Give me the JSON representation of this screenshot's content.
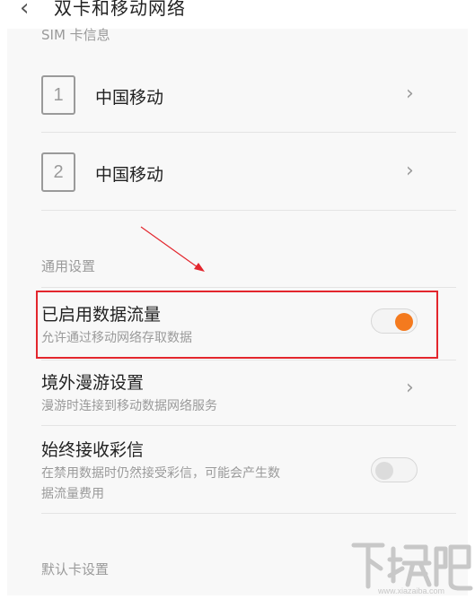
{
  "header": {
    "back_icon": "chevron-left-icon",
    "title": "双卡和移动网络"
  },
  "sim_section": {
    "label": "SIM 卡信息",
    "cards": [
      {
        "slot": "1",
        "name": "中国移动"
      },
      {
        "slot": "2",
        "name": "中国移动"
      }
    ]
  },
  "general_section": {
    "label": "通用设置",
    "items": [
      {
        "title": "已启用数据流量",
        "subtitle": "允许通过移动网络存取数据",
        "control": "toggle",
        "enabled": true
      },
      {
        "title": "境外漫游设置",
        "subtitle": "漫游时连接到移动数据网络服务",
        "control": "chevron"
      },
      {
        "title": "始终接收彩信",
        "subtitle_line1": "在禁用数据时仍然接受彩信，可能会产生数",
        "subtitle_line2": "据流量费用",
        "control": "toggle",
        "enabled": false
      }
    ]
  },
  "default_card_section": {
    "label": "默认卡设置"
  },
  "annotation": {
    "arrow_color": "#e3262d",
    "box_color": "#e3262d"
  },
  "colors": {
    "accent": "#f47a1e",
    "muted_text": "#9a9a9a",
    "panel_bg": "#f8f8f8"
  },
  "watermark": {
    "main": "下载吧",
    "url": "www.xiazaiba.com"
  }
}
